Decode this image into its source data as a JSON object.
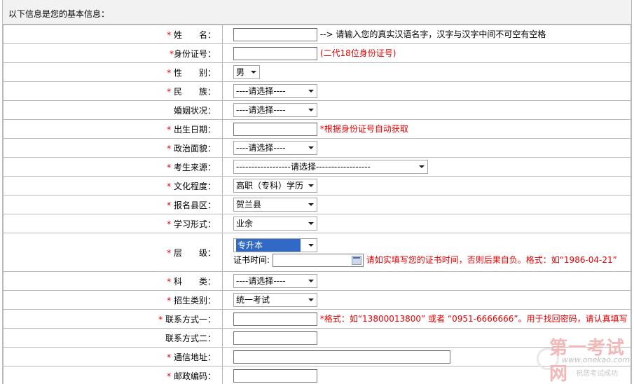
{
  "header": {
    "title": "以下信息是您的基本信息："
  },
  "rows": [
    {
      "id": "name",
      "req": "*",
      "label": "姓　　名：",
      "type": "input",
      "width": 120,
      "hint": "--> 请输入您的真实汉语名字，汉字与汉字中间不可空有空格",
      "hint_style": "blk"
    },
    {
      "id": "idcard",
      "req": "*",
      "label": "身份证号：",
      "type": "input",
      "width": 120,
      "hint": "(二代18位身份证号)",
      "hint_style": "red"
    },
    {
      "id": "gender",
      "req": "*",
      "label": "性　　别：",
      "type": "select",
      "width": 38,
      "value": "男"
    },
    {
      "id": "ethnic",
      "req": "*",
      "label": "民　　族：",
      "type": "select",
      "width": 120,
      "value": "----请选择----"
    },
    {
      "id": "marital",
      "req": "",
      "label": "婚姻状况：",
      "type": "select",
      "width": 120,
      "value": "----请选择----"
    },
    {
      "id": "birthdate",
      "req": "*",
      "label": "出生日期：",
      "type": "input",
      "width": 120,
      "hint": "*根据身份证号自动获取",
      "hint_style": "red"
    },
    {
      "id": "political",
      "req": "*",
      "label": "政治面貌：",
      "type": "select",
      "width": 120,
      "value": "----请选择----"
    },
    {
      "id": "source",
      "req": "*",
      "label": "考生来源：",
      "type": "select",
      "width": 278,
      "value": "------------------请选择------------------"
    },
    {
      "id": "education",
      "req": "*",
      "label": "文化程度：",
      "type": "select",
      "width": 120,
      "value": "高职（专科）学历"
    },
    {
      "id": "county",
      "req": "*",
      "label": "报名县区：",
      "type": "select",
      "width": 120,
      "value": "贺兰县"
    },
    {
      "id": "study_mode",
      "req": "*",
      "label": "学习形式：",
      "type": "select",
      "width": 120,
      "value": "业余"
    },
    {
      "id": "level",
      "req": "*",
      "label": "层　　级：",
      "type": "level",
      "width": 120,
      "value": "专升本",
      "cert_label": "证书时间:",
      "hint": "请如实填写您的证书时间，否则后果自负。格式：如“1986-04-21”",
      "hint_style": "red"
    },
    {
      "id": "subject",
      "req": "*",
      "label": "科　　类：",
      "type": "select",
      "width": 120,
      "value": "----请选择----"
    },
    {
      "id": "enroll_type",
      "req": "*",
      "label": "招生类别：",
      "type": "select",
      "width": 120,
      "value": "统一考试"
    },
    {
      "id": "contact1",
      "req": "*",
      "label": "联系方式一：",
      "type": "input",
      "width": 120,
      "hint": "*格式：如“13800013800” 或者 “0951-6666666”。用于找回密码，请认真填写",
      "hint_style": "red"
    },
    {
      "id": "contact2",
      "req": "",
      "label": "联系方式二：",
      "type": "input",
      "width": 120
    },
    {
      "id": "address",
      "req": "*",
      "label": "通信地址：",
      "type": "input",
      "width": 310
    },
    {
      "id": "postcode",
      "req": "*",
      "label": "邮政编码：",
      "type": "input",
      "width": 120
    }
  ],
  "watermark": {
    "title": "第一考试网",
    "url": "www.onekao.com",
    "slogan": "祝您考试成功"
  }
}
